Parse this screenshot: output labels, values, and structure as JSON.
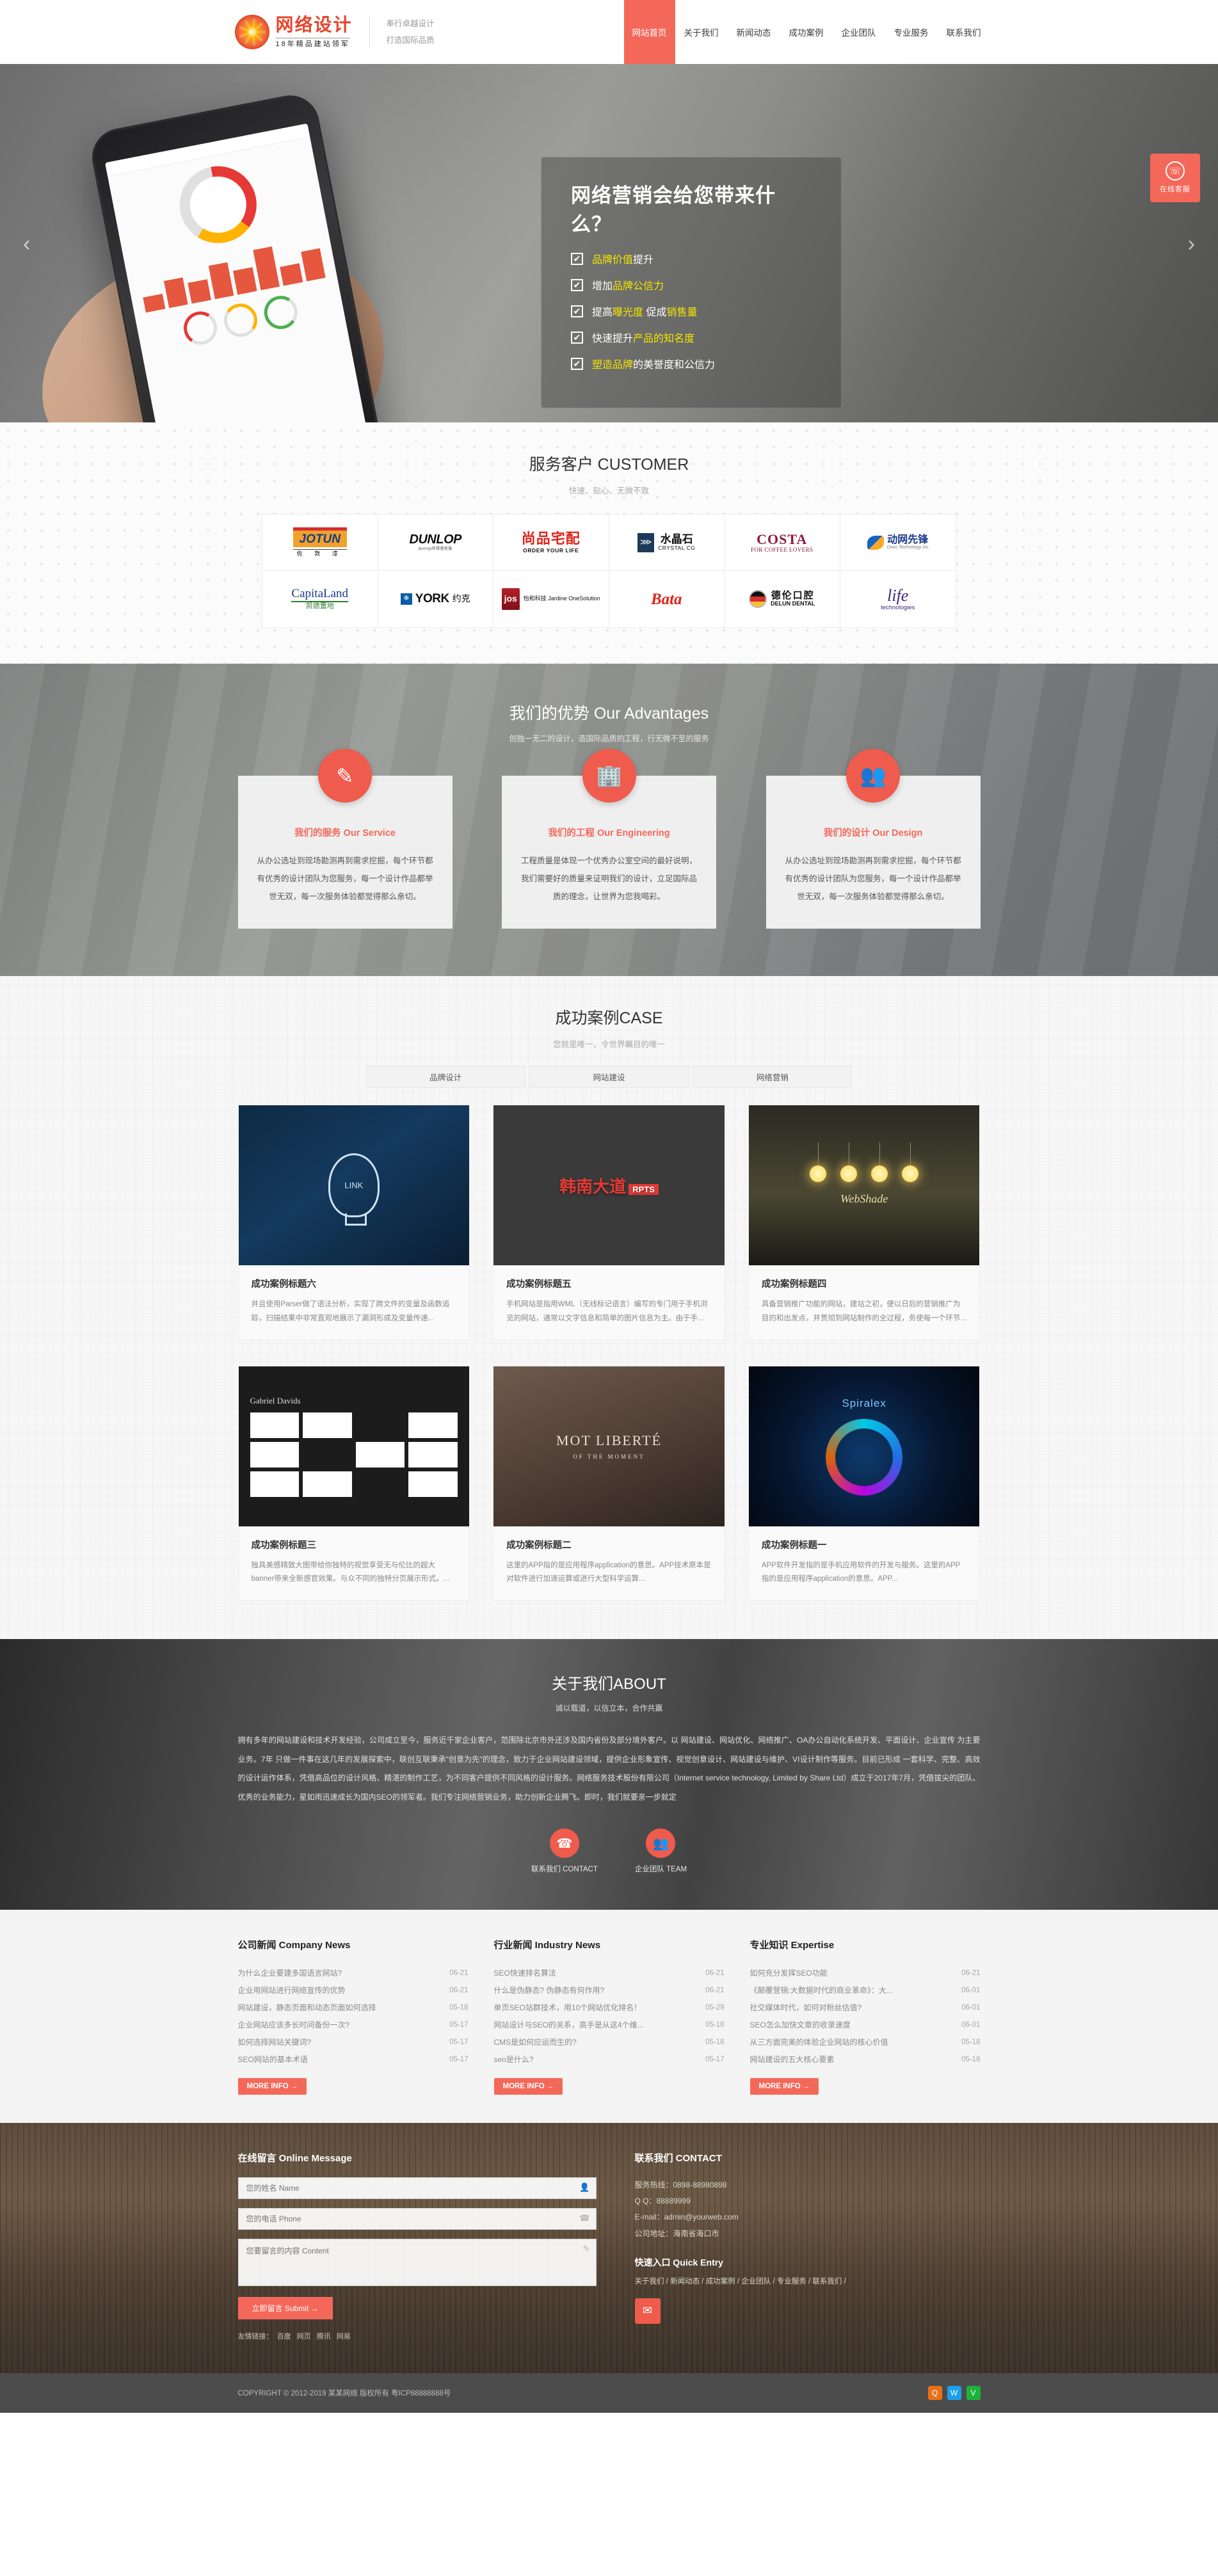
{
  "header": {
    "logo_name": "网络设计",
    "logo_tagline": "18年精品建站领军",
    "slogan_line1": "奉行卓越设计",
    "slogan_line2": "打造国际品质",
    "nav": [
      {
        "label": "网站首页",
        "active": true
      },
      {
        "label": "关于我们",
        "active": false
      },
      {
        "label": "新闻动态",
        "active": false
      },
      {
        "label": "成功案例",
        "active": false
      },
      {
        "label": "企业团队",
        "active": false
      },
      {
        "label": "专业服务",
        "active": false
      },
      {
        "label": "联系我们",
        "active": false
      }
    ]
  },
  "float_box": {
    "icon": "headset-icon",
    "label": "在线客服"
  },
  "hero": {
    "prev_arrow": "‹",
    "next_arrow": "›",
    "title": "网络营销会给您带来什么？",
    "check_glyph": "✔",
    "items": [
      {
        "hl1": "品牌价值",
        "rest1": "提升",
        "plain": ""
      },
      {
        "pre": "增加",
        "hl1": "品牌公信力",
        "rest1": ""
      },
      {
        "pre": "提高",
        "hl1": "曝光度",
        "mid": "  促成",
        "hl2": "销售量"
      },
      {
        "pre": "快速提升",
        "hl1": "产品的知名度"
      },
      {
        "hl1": "塑造品牌",
        "rest1": "的美誉度和公信力"
      }
    ]
  },
  "customer": {
    "title": "服务客户 CUSTOMER",
    "subtitle": "快速、贴心、无微不致",
    "logos": [
      {
        "name": "JOTUN",
        "cn": "佐   敦   漆",
        "style": "jotun"
      },
      {
        "name": "DUNLOP",
        "cn": "dunlop邓禄普轮胎",
        "style": "dunlop"
      },
      {
        "name": "尚品宅配",
        "cn": "ORDER YOUR LIFE",
        "style": "shangpin"
      },
      {
        "name": "水晶石",
        "cn": "CRYSTAL CG",
        "style": "crystalcg"
      },
      {
        "name": "COSTA",
        "cn": "FOR COFFEE LOVERS",
        "style": "costa"
      },
      {
        "name": "动网先锋",
        "cn": "Dovo Technology Inc",
        "style": "dovo"
      },
      {
        "name": "CapitaLand",
        "cn": "凯德置地",
        "style": "capitaland"
      },
      {
        "name": "YORK",
        "cn": "约克",
        "style": "york"
      },
      {
        "name": "jos",
        "cn": "怡和科技 Jardine OneSolution",
        "style": "jos"
      },
      {
        "name": "Bata",
        "cn": "",
        "style": "bata"
      },
      {
        "name": "德伦口腔",
        "cn": "DELUN DENTAL",
        "style": "delun"
      },
      {
        "name": "life",
        "cn": "technologies",
        "style": "life"
      }
    ]
  },
  "advantages": {
    "title": "我们的优势 Our Advantages",
    "subtitle": "创独一无二的设计，造国际品质的工程，行无微不至的服务",
    "cards": [
      {
        "icon": "pencil-icon",
        "glyph": "✎",
        "heading": "我们的服务 Our Service",
        "body": "从办公选址到现场勘测再到需求挖掘，每个环节都有优秀的设计团队为您服务，每一个设计作品都举世无双，每一次服务体验都觉得那么亲切。"
      },
      {
        "icon": "building-icon",
        "glyph": "🏢",
        "heading": "我们的工程 Our Engineering",
        "body": "工程质量是体现一个优秀办公室空间的最好说明，我们需要好的质量来证明我们的设计，立足国际品质的理念，让世界为您我喝彩。"
      },
      {
        "icon": "team-icon",
        "glyph": "👥",
        "heading": "我们的设计 Our Design",
        "body": "从办公选址到现场勘测再到需求挖掘，每个环节都有优秀的设计团队为您服务，每一个设计作品都举世无双，每一次服务体验都觉得那么亲切。"
      }
    ]
  },
  "cases": {
    "title": "成功案例CASE",
    "subtitle": "您就是唯一，令世界瞩目的唯一",
    "tabs": [
      "品牌设计",
      "网站建设",
      "网络营销"
    ],
    "items": [
      {
        "thumb_class": "ci1",
        "thumb_label": "LINK",
        "title": "成功案例标题六",
        "desc": "并且使用Parser做了语法分析，实现了跨文件的变量及函数追踪，扫描结果中非常直观地展示了漏洞形成及变量传递..."
      },
      {
        "thumb_class": "ci2",
        "thumb_label": "韩南大道",
        "thumb_badge": "RPTS",
        "title": "成功案例标题五",
        "desc": "手机网站是指用WML（无线标记语言）编写的专门用于手机浏览的网站，通常以文字信息和简单的图片信息为主。由于手..."
      },
      {
        "thumb_class": "ci3",
        "thumb_label": "WebShade",
        "title": "成功案例标题四",
        "desc": "具备营销推广功能的网站，建站之初，便以日后的营销推广为目的和出发点，并贯彻到网站制作的全过程，务使每一个环节..."
      },
      {
        "thumb_class": "ci4",
        "thumb_label": "Gabriel Davids",
        "title": "成功案例标题三",
        "desc": "独具美感精致大图带给你独特的视觉享受无与伦比的超大banner带来全新感官效果。与众不同的独特分页展示形式。..."
      },
      {
        "thumb_class": "ci5",
        "thumb_label": "MOT LIBERTÉ",
        "thumb_sub": "OF THE MOMENT",
        "title": "成功案例标题二",
        "desc": "这里的APP指的是应用程序application的意思。APP技术原本是对软件进行加速运算或进行大型科学运算..."
      },
      {
        "thumb_class": "ci6",
        "thumb_label": "Spiralex",
        "title": "成功案例标题一",
        "desc": "APP软件开发指的是手机应用软件的开发与服务。这里的APP指的是应用程序application的意思。APP..."
      }
    ]
  },
  "about": {
    "title": "关于我们ABOUT",
    "subtitle": "诚以载道，以信立本，合作共赢",
    "body": "拥有多年的网站建设和技术开发经验，公司成立至今，服务近千家企业客户，范围除北京市外还涉及国内省份及部分境外客户。以 网站建设、网站优化、网络推广、OA办公自动化系统开发、平面设计、企业宣传 为主要业务。7年 只做一件事在这几年的发展探索中，联创互联秉承\"创意为先\"的理念，致力于企业网站建设领域，提供企业形象宣传、视觉创意设计、网站建设与维护、VI设计制作等服务。目前已形成 一套科学、完整、高效的设计运作体系，凭借高品位的设计风格、精湛的制作工艺，为不同客户提供不同风格的设计服务。网络服务技术股份有限公司（Internet service technology, Limited by Share Ltd）成立于2017年7月，凭借拔尖的团队、优秀的业务能力，星如雨迅速成长为国内SEO的领军者。我们专注网络营销业务，助力创新企业腾飞。即时，我们就要亲一步就定",
    "actions": [
      {
        "icon": "phone-icon",
        "glyph": "☎",
        "label": "联系我们 CONTACT"
      },
      {
        "icon": "team-icon",
        "glyph": "👥",
        "label": "企业团队 TEAM"
      }
    ]
  },
  "news": {
    "more_label": "MORE INFO →",
    "columns": [
      {
        "heading": "公司新闻 Company News",
        "items": [
          {
            "title": "为什么企业要建多国语言网站?",
            "date": "06-21"
          },
          {
            "title": "企业用网站进行网络宣传的优势",
            "date": "06-21"
          },
          {
            "title": "网站建设，静态页面和动态页面如何选择",
            "date": "05-18"
          },
          {
            "title": "企业网站应该多长时间备份一次?",
            "date": "05-17"
          },
          {
            "title": "如何选择网站关键词?",
            "date": "05-17"
          },
          {
            "title": "SEO网站的基本术语",
            "date": "05-17"
          }
        ]
      },
      {
        "heading": "行业新闻 Industry News",
        "items": [
          {
            "title": "SEO快速排名算法",
            "date": "06-21"
          },
          {
            "title": "什么是伪静态? 伪静态有何作用?",
            "date": "06-21"
          },
          {
            "title": "单页SEO站群技术，用10个网站优化排名！",
            "date": "05-29"
          },
          {
            "title": "网站设计与SEO的关系，高手是从这4个维...",
            "date": "05-18"
          },
          {
            "title": "CMS是如何应运而生的?",
            "date": "05-18"
          },
          {
            "title": "seo是什么?",
            "date": "05-17"
          }
        ]
      },
      {
        "heading": "专业知识 Expertise",
        "items": [
          {
            "title": "如何充分发挥SEO功能",
            "date": "06-21"
          },
          {
            "title": "《颠覆营销:大数据时代的商业革命》：大...",
            "date": "06-01"
          },
          {
            "title": "社交媒体时代，如何对粉丝估值?",
            "date": "06-01"
          },
          {
            "title": "SEO怎么加快文章的收录速度",
            "date": "06-01"
          },
          {
            "title": "从三方面完美的体验企业网站的核心价值",
            "date": "05-18"
          },
          {
            "title": "网站建设的五大核心要素",
            "date": "05-18"
          }
        ]
      }
    ]
  },
  "message": {
    "heading": "在线留言 Online Message",
    "fields": [
      {
        "name": "name",
        "placeholder": "您的姓名 Name",
        "value": "",
        "icon": "user-icon",
        "glyph": "👤"
      },
      {
        "name": "phone",
        "placeholder": "您的电话 Phone",
        "value": "",
        "icon": "phone-icon",
        "glyph": "☎"
      },
      {
        "name": "content",
        "placeholder": "您要留言的内容 Content",
        "value": "",
        "icon": "pencil-icon",
        "glyph": "✎"
      }
    ],
    "submit_label": "立即留言 Submit →",
    "note_prefix": "友情链接：",
    "note_links": [
      "百度",
      "网页",
      "腾讯",
      "网易"
    ]
  },
  "contact": {
    "heading": "联系我们 CONTACT",
    "lines": [
      "服务热线：0898-88980898",
      "Q  Q：88889999",
      "E-mail：admin@yourweb.com",
      "公司地址：海南省海口市"
    ],
    "quick_heading": "快速入口 Quick Entry",
    "quick_links": "关于我们 / 新闻动态 / 成功案例 / 企业团队 / 专业服务 / 联系我们 /",
    "wechat_icon": "wechat-icon",
    "wechat_glyph": "✉"
  },
  "footer": {
    "copyright": "COPYRIGHT © 2012-2019 某某网络 版权所有   粤ICP88888888号",
    "icons": [
      {
        "name": "qq-icon",
        "glyph": "Q"
      },
      {
        "name": "weibo-icon",
        "glyph": "W"
      },
      {
        "name": "wechat-icon",
        "glyph": "V"
      }
    ]
  },
  "colors": {
    "accent": "#f4685a",
    "accent_dark": "#ef5b4c",
    "highlight_yellow": "#f2e500"
  }
}
